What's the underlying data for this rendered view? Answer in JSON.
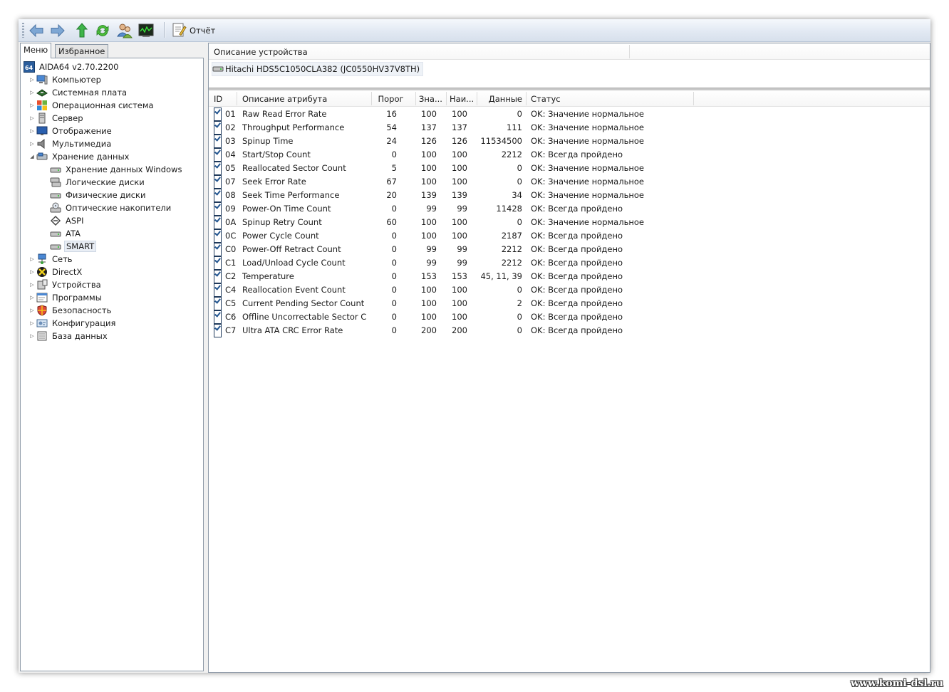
{
  "toolbar": {
    "report_label": "Отчёт"
  },
  "tabs": [
    "Меню",
    "Избранное"
  ],
  "tree": [
    {
      "label": "AIDA64 v2.70.2200",
      "icon": "aida64-icon"
    },
    {
      "label": "Компьютер",
      "icon": "computer-icon"
    },
    {
      "label": "Системная плата",
      "icon": "motherboard-icon"
    },
    {
      "label": "Операционная система",
      "icon": "windows-icon"
    },
    {
      "label": "Сервер",
      "icon": "server-icon"
    },
    {
      "label": "Отображение",
      "icon": "monitor-icon"
    },
    {
      "label": "Мультимедиа",
      "icon": "speaker-icon"
    },
    {
      "label": "Хранение данных",
      "icon": "storage-icon"
    },
    {
      "label": "Хранение данных Windows",
      "icon": "drive-icon"
    },
    {
      "label": "Логические диски",
      "icon": "logical-drive-icon"
    },
    {
      "label": "Физические диски",
      "icon": "drive-icon"
    },
    {
      "label": "Оптические накопители",
      "icon": "optical-drive-icon"
    },
    {
      "label": "ASPI",
      "icon": "aspi-icon"
    },
    {
      "label": "ATA",
      "icon": "drive-icon"
    },
    {
      "label": "SMART",
      "icon": "drive-icon"
    },
    {
      "label": "Сеть",
      "icon": "network-icon"
    },
    {
      "label": "DirectX",
      "icon": "directx-icon"
    },
    {
      "label": "Устройства",
      "icon": "devices-icon"
    },
    {
      "label": "Программы",
      "icon": "programs-icon"
    },
    {
      "label": "Безопасность",
      "icon": "shield-icon"
    },
    {
      "label": "Конфигурация",
      "icon": "config-icon"
    },
    {
      "label": "База данных",
      "icon": "database-icon"
    }
  ],
  "device": {
    "header": "Описание устройства",
    "name": "Hitachi HDS5C1050CLA382 (JC0550HV37V8TH)"
  },
  "columns": {
    "id": "ID",
    "desc": "Описание атрибута",
    "threshold": "Порог",
    "value": "Зна...",
    "worst": "Наи...",
    "data": "Данные",
    "status": "Статус"
  },
  "rows": [
    {
      "id": "01",
      "desc": "Raw Read Error Rate",
      "thr": "16",
      "val": "100",
      "worst": "100",
      "data": "0",
      "status": "OK: Значение нормальное"
    },
    {
      "id": "02",
      "desc": "Throughput Performance",
      "thr": "54",
      "val": "137",
      "worst": "137",
      "data": "111",
      "status": "OK: Значение нормальное"
    },
    {
      "id": "03",
      "desc": "Spinup Time",
      "thr": "24",
      "val": "126",
      "worst": "126",
      "data": "11534500",
      "status": "OK: Значение нормальное"
    },
    {
      "id": "04",
      "desc": "Start/Stop Count",
      "thr": "0",
      "val": "100",
      "worst": "100",
      "data": "2212",
      "status": "OK: Всегда пройдено"
    },
    {
      "id": "05",
      "desc": "Reallocated Sector Count",
      "thr": "5",
      "val": "100",
      "worst": "100",
      "data": "0",
      "status": "OK: Значение нормальное"
    },
    {
      "id": "07",
      "desc": "Seek Error Rate",
      "thr": "67",
      "val": "100",
      "worst": "100",
      "data": "0",
      "status": "OK: Значение нормальное"
    },
    {
      "id": "08",
      "desc": "Seek Time Performance",
      "thr": "20",
      "val": "139",
      "worst": "139",
      "data": "34",
      "status": "OK: Значение нормальное"
    },
    {
      "id": "09",
      "desc": "Power-On Time Count",
      "thr": "0",
      "val": "99",
      "worst": "99",
      "data": "11428",
      "status": "OK: Всегда пройдено"
    },
    {
      "id": "0A",
      "desc": "Spinup Retry Count",
      "thr": "60",
      "val": "100",
      "worst": "100",
      "data": "0",
      "status": "OK: Значение нормальное"
    },
    {
      "id": "0C",
      "desc": "Power Cycle Count",
      "thr": "0",
      "val": "100",
      "worst": "100",
      "data": "2187",
      "status": "OK: Всегда пройдено"
    },
    {
      "id": "C0",
      "desc": "Power-Off Retract Count",
      "thr": "0",
      "val": "99",
      "worst": "99",
      "data": "2212",
      "status": "OK: Всегда пройдено"
    },
    {
      "id": "C1",
      "desc": "Load/Unload Cycle Count",
      "thr": "0",
      "val": "99",
      "worst": "99",
      "data": "2212",
      "status": "OK: Всегда пройдено"
    },
    {
      "id": "C2",
      "desc": "Temperature",
      "thr": "0",
      "val": "153",
      "worst": "153",
      "data": "45, 11, 39",
      "status": "OK: Всегда пройдено"
    },
    {
      "id": "C4",
      "desc": "Reallocation Event Count",
      "thr": "0",
      "val": "100",
      "worst": "100",
      "data": "0",
      "status": "OK: Всегда пройдено"
    },
    {
      "id": "C5",
      "desc": "Current Pending Sector Count",
      "thr": "0",
      "val": "100",
      "worst": "100",
      "data": "2",
      "status": "OK: Всегда пройдено"
    },
    {
      "id": "C6",
      "desc": "Offline Uncorrectable Sector C...",
      "thr": "0",
      "val": "100",
      "worst": "100",
      "data": "0",
      "status": "OK: Всегда пройдено"
    },
    {
      "id": "C7",
      "desc": "Ultra ATA CRC Error Rate",
      "thr": "0",
      "val": "200",
      "worst": "200",
      "data": "0",
      "status": "OK: Всегда пройдено"
    }
  ],
  "watermark": "www.komi-dsl.ru"
}
